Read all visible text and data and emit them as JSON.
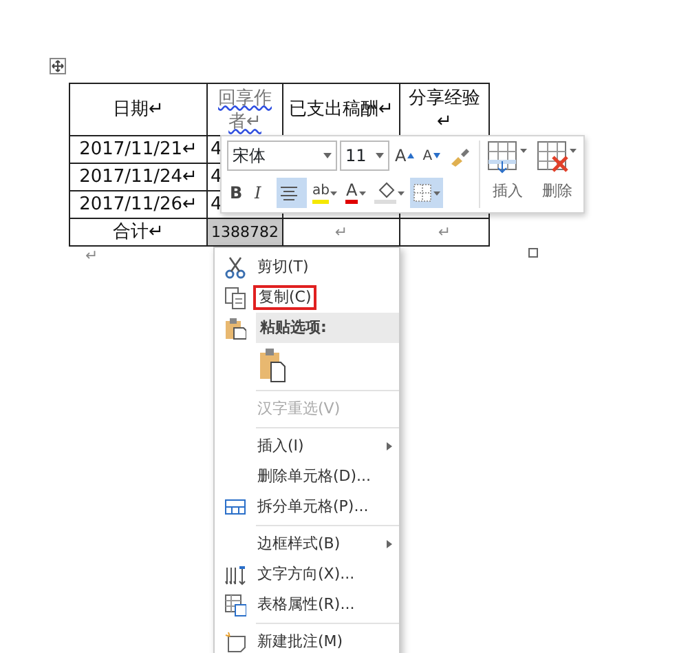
{
  "table": {
    "header": [
      "日期↵",
      "回享作者↵",
      "已支出稿酬↵",
      "分享经验↵"
    ],
    "rows": [
      [
        "2017/11/21↵",
        "4"
      ],
      [
        "2017/11/24↵",
        "4"
      ],
      [
        "2017/11/26↵",
        "4"
      ]
    ],
    "total": [
      {
        "text": "合计↵",
        "selected": false
      },
      {
        "text": "1388782",
        "selected": true
      },
      {
        "text": "↵",
        "selected": false
      },
      {
        "text": "↵",
        "selected": false
      }
    ]
  },
  "after_table_mark": "↵",
  "toolbar": {
    "font": "宋体",
    "size": "11",
    "buttons": [
      {
        "kind": "grow",
        "glyph": "A",
        "selected": false
      },
      {
        "kind": "shrink",
        "glyph": "A",
        "selected": false
      },
      {
        "kind": "painter",
        "selected": false
      }
    ],
    "format": [
      {
        "kind": "bold",
        "label": "B",
        "selected": false
      },
      {
        "kind": "italic",
        "label": "I",
        "selected": false
      },
      {
        "kind": "align",
        "selected": true
      },
      {
        "kind": "highlight",
        "glyph": "ab",
        "selected": false
      },
      {
        "kind": "fontcolor",
        "glyph": "A",
        "selected": false
      },
      {
        "kind": "shading",
        "selected": false
      },
      {
        "kind": "borders",
        "selected": true
      }
    ],
    "insert_label": "插入",
    "delete_label": "删除"
  },
  "menu": [
    {
      "kind": "item",
      "label": "剪切(T)",
      "highlighted": false,
      "disabled": false,
      "submenu": false
    },
    {
      "kind": "item",
      "label": "复制(C)",
      "highlighted": true,
      "disabled": false,
      "submenu": false
    },
    {
      "kind": "header",
      "label": "粘贴选项:"
    },
    {
      "kind": "paste"
    },
    {
      "kind": "separator"
    },
    {
      "kind": "item",
      "label": "汉字重选(V)",
      "highlighted": false,
      "disabled": true,
      "submenu": false
    },
    {
      "kind": "separator"
    },
    {
      "kind": "item",
      "label": "插入(I)",
      "highlighted": false,
      "disabled": false,
      "submenu": true
    },
    {
      "kind": "item",
      "label": "删除单元格(D)...",
      "highlighted": false,
      "disabled": false,
      "submenu": false
    },
    {
      "kind": "item",
      "label": "拆分单元格(P)...",
      "highlighted": false,
      "disabled": false,
      "submenu": false
    },
    {
      "kind": "separator"
    },
    {
      "kind": "item",
      "label": "边框样式(B)",
      "highlighted": false,
      "disabled": false,
      "submenu": true
    },
    {
      "kind": "item",
      "label": "文字方向(X)...",
      "highlighted": false,
      "disabled": false,
      "submenu": false
    },
    {
      "kind": "item",
      "label": "表格属性(R)...",
      "highlighted": false,
      "disabled": false,
      "submenu": false
    },
    {
      "kind": "separator"
    },
    {
      "kind": "item",
      "label": "新建批注(M)",
      "highlighted": false,
      "disabled": false,
      "submenu": false
    }
  ]
}
